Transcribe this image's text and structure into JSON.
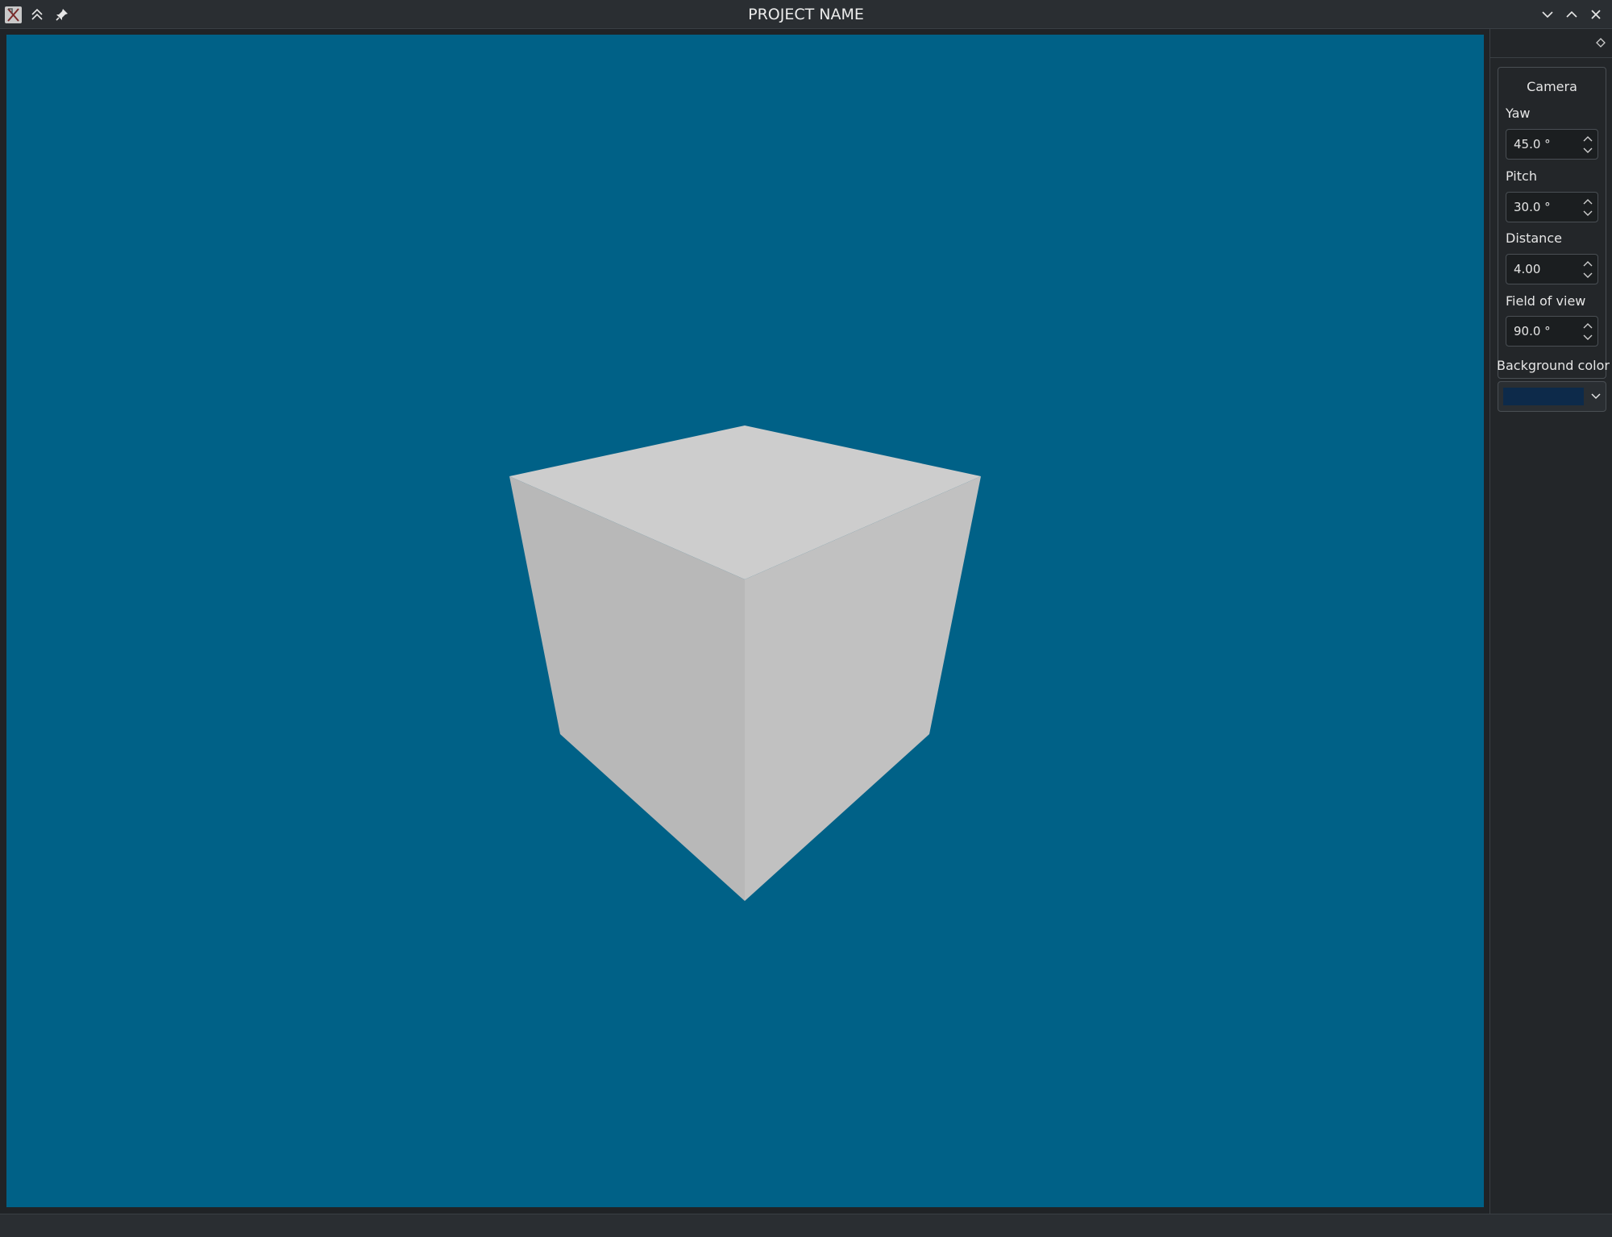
{
  "window": {
    "title": "PROJECT NAME"
  },
  "viewport": {
    "background_color": "#006187",
    "cube_colors": {
      "top": "#cdcdcd",
      "left": "#b8b8b8",
      "right": "#c1c1c1"
    }
  },
  "panel": {
    "camera": {
      "title": "Camera",
      "fields": [
        {
          "label": "Yaw",
          "value": "45.0 °"
        },
        {
          "label": "Pitch",
          "value": "30.0 °"
        },
        {
          "label": "Distance",
          "value": "4.00"
        },
        {
          "label": "Field of view",
          "value": "90.0 °"
        }
      ]
    },
    "background": {
      "label": "Background color",
      "swatch_color": "#0d2a4a"
    }
  },
  "icons": {
    "app": "app-icon",
    "keep_above": "double-chevron-up-icon",
    "pin": "pin-icon",
    "minimize": "chevron-down-icon",
    "maximize": "chevron-up-icon",
    "close": "close-icon",
    "float": "diamond-icon"
  }
}
